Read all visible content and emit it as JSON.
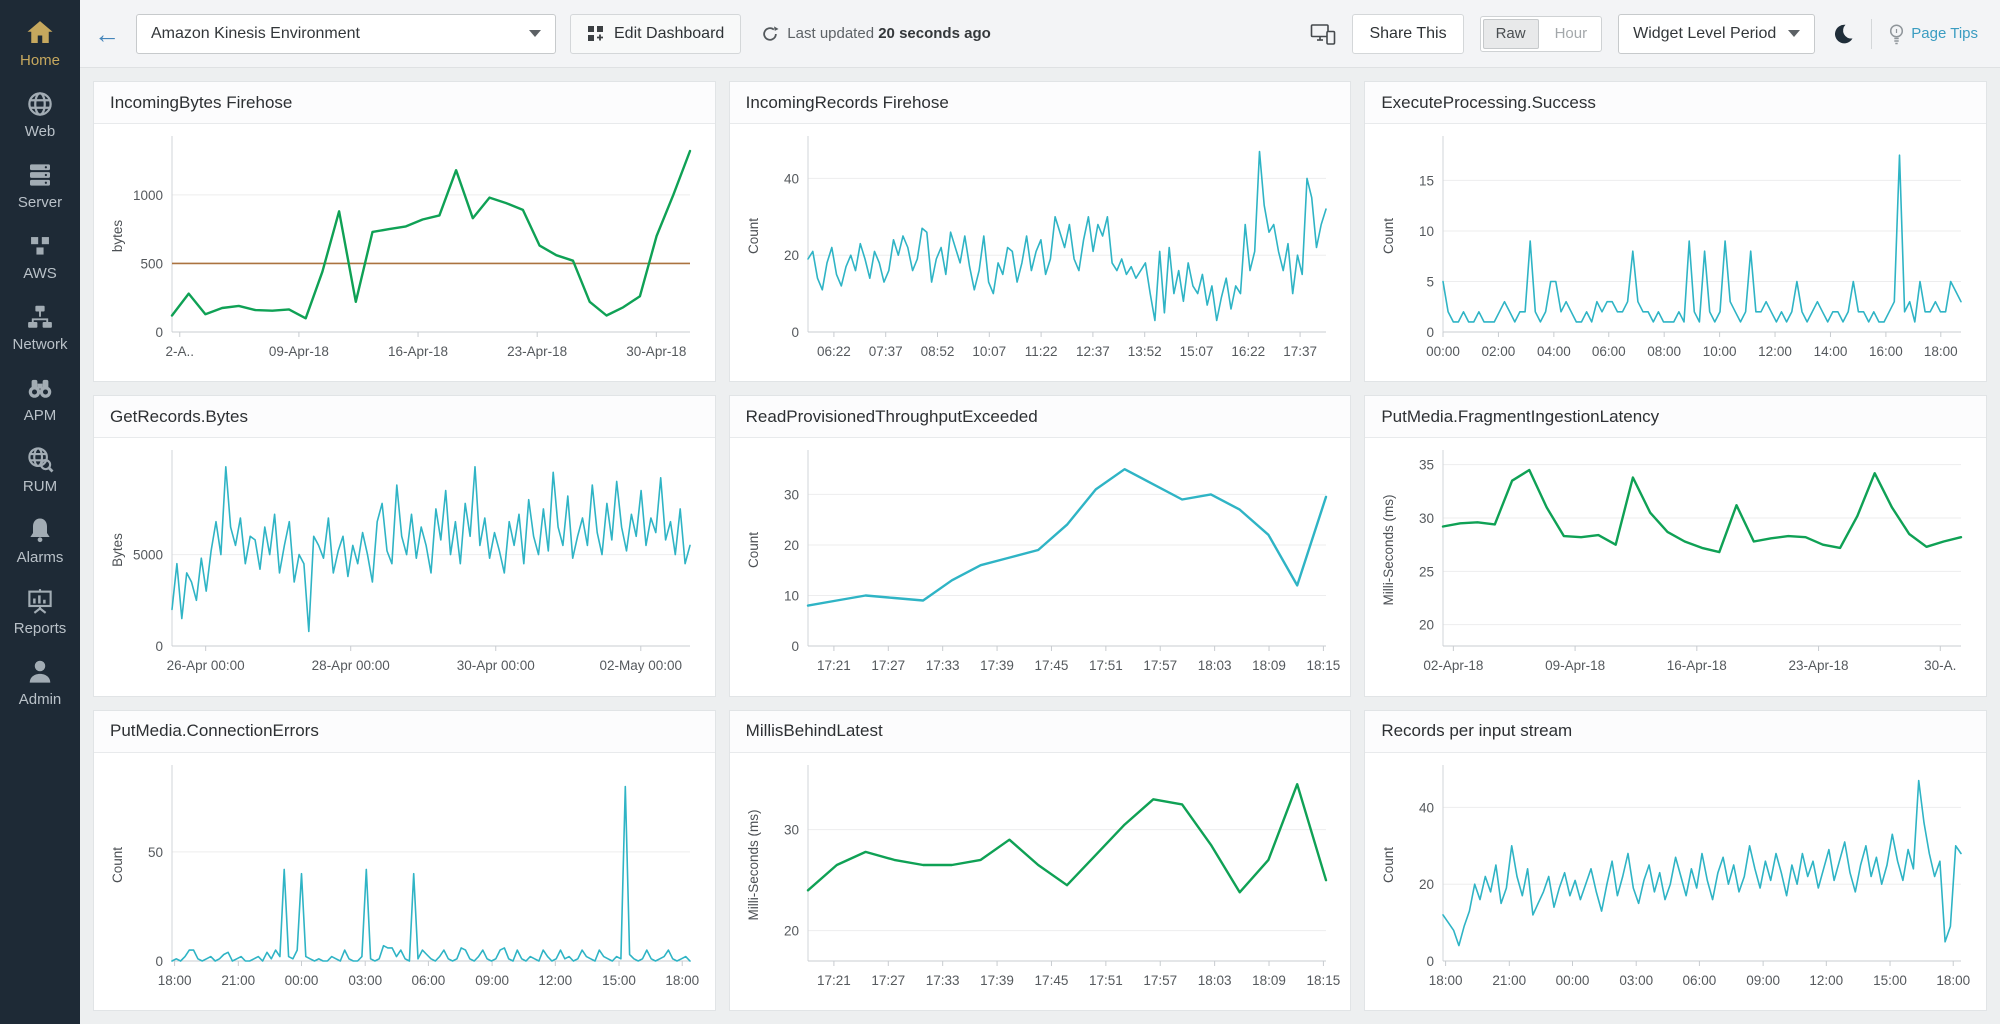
{
  "sidebar": {
    "items": [
      {
        "label": "Home",
        "icon": "home-icon",
        "active": true
      },
      {
        "label": "Web",
        "icon": "globe-icon",
        "active": false
      },
      {
        "label": "Server",
        "icon": "server-icon",
        "active": false
      },
      {
        "label": "AWS",
        "icon": "cubes-icon",
        "active": false
      },
      {
        "label": "Network",
        "icon": "network-icon",
        "active": false
      },
      {
        "label": "APM",
        "icon": "binoculars-icon",
        "active": false
      },
      {
        "label": "RUM",
        "icon": "globe-search-icon",
        "active": false
      },
      {
        "label": "Alarms",
        "icon": "bell-icon",
        "active": false
      },
      {
        "label": "Reports",
        "icon": "report-board-icon",
        "active": false
      },
      {
        "label": "Admin",
        "icon": "person-icon",
        "active": false
      }
    ]
  },
  "header": {
    "dashboard_select": "Amazon Kinesis Environment",
    "edit_dashboard_label": "Edit Dashboard",
    "last_updated_prefix": "Last updated",
    "last_updated_value": "20 seconds ago",
    "share_label": "Share This",
    "period_toggle": {
      "options": [
        "Raw",
        "Hour"
      ],
      "selected": "Raw"
    },
    "widget_period_label": "Widget Level Period",
    "page_tips_label": "Page Tips"
  },
  "colors": {
    "green_series": "#0fa155",
    "teal_series": "#2fb4c5",
    "threshold": "#ab7340",
    "sidebar_bg": "#1e2a36",
    "accent_gold": "#c6a85e",
    "page_tips_blue": "#3a9cc1"
  },
  "chart_data": [
    {
      "type": "line",
      "title": "IncomingBytes Firehose",
      "ylabel": "bytes",
      "color": "#0fa155",
      "stroke": 2.4,
      "ylim": [
        0,
        1400
      ],
      "yticks": [
        0,
        500,
        1000
      ],
      "threshold": 500,
      "x_labels": [
        "2-A..",
        "09-Apr-18",
        "16-Apr-18",
        "23-Apr-18",
        "30-Apr-18"
      ],
      "tick_fracs": [
        0.015,
        0.245,
        0.475,
        0.705,
        0.935
      ],
      "values": [
        120,
        280,
        130,
        175,
        190,
        160,
        155,
        165,
        100,
        440,
        880,
        220,
        730,
        750,
        770,
        820,
        850,
        1180,
        830,
        980,
        940,
        890,
        630,
        560,
        520,
        220,
        120,
        180,
        260,
        700,
        1000,
        1320
      ]
    },
    {
      "type": "line",
      "title": "IncomingRecords Firehose",
      "ylabel": "Count",
      "color": "#2fb4c5",
      "stroke": 1.6,
      "ylim": [
        0,
        50
      ],
      "yticks": [
        0,
        20,
        40
      ],
      "x_labels": [
        "06:22",
        "07:37",
        "08:52",
        "10:07",
        "11:22",
        "12:37",
        "13:52",
        "15:07",
        "16:22",
        "17:37"
      ],
      "tick_fracs": [
        0.05,
        0.15,
        0.25,
        0.35,
        0.45,
        0.55,
        0.65,
        0.75,
        0.85,
        0.95
      ],
      "values": [
        19,
        21,
        14,
        11,
        18,
        22,
        15,
        12,
        17,
        20,
        16,
        23,
        19,
        14,
        21,
        18,
        13,
        16,
        24,
        20,
        25,
        22,
        16,
        19,
        27,
        26,
        13,
        19,
        22,
        15,
        26,
        22,
        18,
        25,
        17,
        11,
        16,
        25,
        13,
        10,
        18,
        15,
        22,
        21,
        13,
        18,
        25,
        16,
        21,
        24,
        15,
        19,
        30,
        26,
        22,
        28,
        19,
        16,
        24,
        30,
        21,
        28,
        25,
        30,
        18,
        16,
        19,
        15,
        17,
        14,
        16,
        18,
        10,
        3,
        21,
        5,
        22,
        10,
        16,
        8,
        18,
        12,
        10,
        15,
        7,
        12,
        3,
        9,
        14,
        6,
        12,
        10,
        28,
        16,
        21,
        47,
        33,
        26,
        28,
        21,
        16,
        23,
        10,
        20,
        15,
        40,
        35,
        22,
        28,
        32
      ]
    },
    {
      "type": "line",
      "title": "ExecuteProcessing.Success",
      "ylabel": "Count",
      "color": "#2fb4c5",
      "stroke": 1.6,
      "ylim": [
        0,
        19
      ],
      "yticks": [
        0,
        5,
        10,
        15
      ],
      "x_labels": [
        "00:00",
        "02:00",
        "04:00",
        "06:00",
        "08:00",
        "10:00",
        "12:00",
        "14:00",
        "16:00",
        "18:00"
      ],
      "tick_fracs": [
        0.0,
        0.107,
        0.214,
        0.32,
        0.427,
        0.534,
        0.641,
        0.748,
        0.855,
        0.961
      ],
      "values": [
        5,
        2,
        1,
        1,
        2,
        1,
        1,
        2,
        1,
        1,
        1,
        2,
        3,
        2,
        1,
        2,
        2,
        9,
        2,
        1,
        2,
        5,
        5,
        2,
        3,
        2,
        1,
        1,
        2,
        1,
        3,
        2,
        3,
        3,
        2,
        2,
        3,
        8,
        3,
        2,
        2,
        1,
        2,
        1,
        1,
        1,
        2,
        1,
        9,
        2,
        1,
        8,
        2,
        1,
        2,
        9,
        3,
        2,
        1,
        2,
        8,
        2,
        2,
        3,
        2,
        1,
        2,
        1,
        2,
        5,
        2,
        1,
        2,
        3,
        2,
        1,
        2,
        2,
        1,
        2,
        5,
        2,
        2,
        1,
        2,
        1,
        1,
        2,
        3,
        17.5,
        2,
        3,
        1,
        5,
        2,
        2,
        3,
        2,
        2,
        5,
        4,
        3
      ]
    },
    {
      "type": "line",
      "title": "GetRecords.Bytes",
      "ylabel": "Bytes",
      "color": "#2fb4c5",
      "stroke": 1.6,
      "ylim": [
        0,
        10500
      ],
      "yticks": [
        0,
        5000
      ],
      "x_labels": [
        "26-Apr 00:00",
        "28-Apr 00:00",
        "30-Apr 00:00",
        "02-May 00:00"
      ],
      "tick_fracs": [
        0.065,
        0.345,
        0.625,
        0.905
      ],
      "values": [
        2000,
        4500,
        1500,
        4000,
        3500,
        2500,
        4800,
        3000,
        5200,
        6800,
        5000,
        9800,
        6500,
        5500,
        7000,
        4500,
        6000,
        5800,
        4200,
        6500,
        5000,
        7200,
        4000,
        5500,
        6800,
        3500,
        5000,
        4500,
        800,
        6000,
        5500,
        4800,
        7000,
        4000,
        5200,
        6000,
        3800,
        5500,
        4500,
        6200,
        5000,
        3500,
        6800,
        7800,
        5200,
        4500,
        8800,
        6000,
        5000,
        7200,
        4800,
        6500,
        5500,
        4000,
        7500,
        5800,
        8500,
        5000,
        6800,
        4500,
        7800,
        6000,
        9800,
        5500,
        7000,
        4800,
        6200,
        5200,
        4000,
        6800,
        5500,
        7200,
        4500,
        8000,
        6000,
        5000,
        7500,
        5200,
        9500,
        6500,
        5500,
        8200,
        4800,
        6000,
        7000,
        5500,
        8800,
        6200,
        5000,
        7800,
        5800,
        9000,
        6500,
        5200,
        7200,
        6000,
        8500,
        5500,
        7000,
        6200,
        9200,
        5800,
        6800,
        5000,
        7500,
        4500,
        5500
      ]
    },
    {
      "type": "line",
      "title": "ReadProvisionedThroughputExceeded",
      "ylabel": "Count",
      "color": "#2fb4c5",
      "stroke": 2.4,
      "ylim": [
        0,
        38
      ],
      "yticks": [
        0,
        10,
        20,
        30
      ],
      "x_labels": [
        "17:21",
        "17:27",
        "17:33",
        "17:39",
        "17:45",
        "17:51",
        "17:57",
        "18:03",
        "18:09",
        "18:15"
      ],
      "tick_fracs": [
        0.05,
        0.155,
        0.26,
        0.365,
        0.47,
        0.575,
        0.68,
        0.785,
        0.89,
        0.995
      ],
      "values": [
        8,
        9,
        10,
        9.5,
        9,
        13,
        16,
        17.5,
        19,
        24,
        31,
        35,
        32,
        29,
        30,
        27,
        22,
        12,
        29.5
      ]
    },
    {
      "type": "line",
      "title": "PutMedia.FragmentIngestionLatency",
      "ylabel": "Milli-Seconds (ms)",
      "color": "#0fa155",
      "stroke": 2.4,
      "ylim": [
        18,
        36
      ],
      "yticks": [
        20,
        25,
        30,
        35
      ],
      "x_labels": [
        "02-Apr-18",
        "09-Apr-18",
        "16-Apr-18",
        "23-Apr-18",
        "30-A."
      ],
      "tick_fracs": [
        0.02,
        0.255,
        0.49,
        0.725,
        0.96
      ],
      "values": [
        29.2,
        29.5,
        29.6,
        29.4,
        33.5,
        34.5,
        31,
        28.3,
        28.2,
        28.4,
        27.5,
        33.8,
        30.5,
        28.7,
        27.8,
        27.2,
        26.8,
        31.2,
        27.8,
        28.1,
        28.3,
        28.2,
        27.5,
        27.2,
        30.2,
        34.2,
        31,
        28.5,
        27.3,
        27.8,
        28.2
      ]
    },
    {
      "type": "line",
      "title": "PutMedia.ConnectionErrors",
      "ylabel": "Count",
      "color": "#2fb4c5",
      "stroke": 1.6,
      "ylim": [
        0,
        88
      ],
      "yticks": [
        0,
        50
      ],
      "x_labels": [
        "18:00",
        "21:00",
        "00:00",
        "03:00",
        "06:00",
        "09:00",
        "12:00",
        "15:00",
        "18:00"
      ],
      "tick_fracs": [
        0.005,
        0.128,
        0.25,
        0.373,
        0.495,
        0.618,
        0.74,
        0.863,
        0.985
      ],
      "values": [
        0,
        1,
        0,
        2,
        5,
        5,
        1,
        0,
        1,
        2,
        0,
        1,
        3,
        4,
        0,
        1,
        2,
        0,
        0,
        1,
        2,
        0,
        4,
        1,
        5,
        2,
        42,
        2,
        1,
        5,
        40,
        2,
        1,
        0,
        1,
        0,
        0,
        2,
        1,
        0,
        5,
        1,
        0,
        0,
        2,
        42,
        1,
        0,
        1,
        7,
        6,
        6,
        2,
        5,
        1,
        0,
        40,
        1,
        5,
        3,
        1,
        0,
        2,
        5,
        1,
        0,
        1,
        6,
        5,
        1,
        0,
        2,
        5,
        1,
        0,
        1,
        5,
        6,
        1,
        0,
        5,
        1,
        0,
        2,
        1,
        0,
        5,
        2,
        0,
        1,
        5,
        1,
        2,
        0,
        1,
        5,
        2,
        1,
        0,
        5,
        2,
        1,
        0,
        2,
        1,
        80,
        3,
        1,
        0,
        1,
        5,
        1,
        0,
        1,
        2,
        5,
        1,
        0,
        1,
        2,
        0
      ]
    },
    {
      "type": "line",
      "title": "MillisBehindLatest",
      "ylabel": "Milli-Seconds (ms)",
      "color": "#0fa155",
      "stroke": 2.4,
      "ylim": [
        17,
        36
      ],
      "yticks": [
        20,
        30
      ],
      "x_labels": [
        "17:21",
        "17:27",
        "17:33",
        "17:39",
        "17:45",
        "17:51",
        "17:57",
        "18:03",
        "18:09",
        "18:15"
      ],
      "tick_fracs": [
        0.05,
        0.155,
        0.26,
        0.365,
        0.47,
        0.575,
        0.68,
        0.785,
        0.89,
        0.995
      ],
      "values": [
        24,
        26.5,
        27.8,
        27,
        26.5,
        26.5,
        27,
        29,
        26.5,
        24.5,
        27.5,
        30.5,
        33,
        32.5,
        28.5,
        23.8,
        27,
        34.5,
        25
      ]
    },
    {
      "type": "line",
      "title": "Records per input stream",
      "ylabel": "Count",
      "color": "#2fb4c5",
      "stroke": 1.6,
      "ylim": [
        0,
        50
      ],
      "yticks": [
        0,
        20,
        40
      ],
      "x_labels": [
        "18:00",
        "21:00",
        "00:00",
        "03:00",
        "06:00",
        "09:00",
        "12:00",
        "15:00",
        "18:00"
      ],
      "tick_fracs": [
        0.005,
        0.128,
        0.25,
        0.373,
        0.495,
        0.618,
        0.74,
        0.863,
        0.985
      ],
      "values": [
        12,
        10,
        8,
        4,
        9,
        13,
        20,
        16,
        22,
        18,
        25,
        15,
        19,
        30,
        22,
        17,
        24,
        12,
        15,
        18,
        22,
        14,
        19,
        23,
        17,
        21,
        16,
        20,
        24,
        18,
        13,
        20,
        26,
        17,
        22,
        28,
        19,
        15,
        21,
        25,
        18,
        23,
        16,
        20,
        27,
        22,
        17,
        24,
        19,
        28,
        21,
        16,
        23,
        27,
        20,
        25,
        18,
        22,
        30,
        24,
        19,
        26,
        21,
        28,
        23,
        17,
        25,
        20,
        28,
        22,
        26,
        19,
        24,
        29,
        21,
        26,
        31,
        23,
        18,
        25,
        30,
        22,
        27,
        20,
        25,
        33,
        26,
        21,
        29,
        24,
        47,
        36,
        28,
        22,
        26,
        5,
        9,
        30,
        28
      ]
    }
  ]
}
